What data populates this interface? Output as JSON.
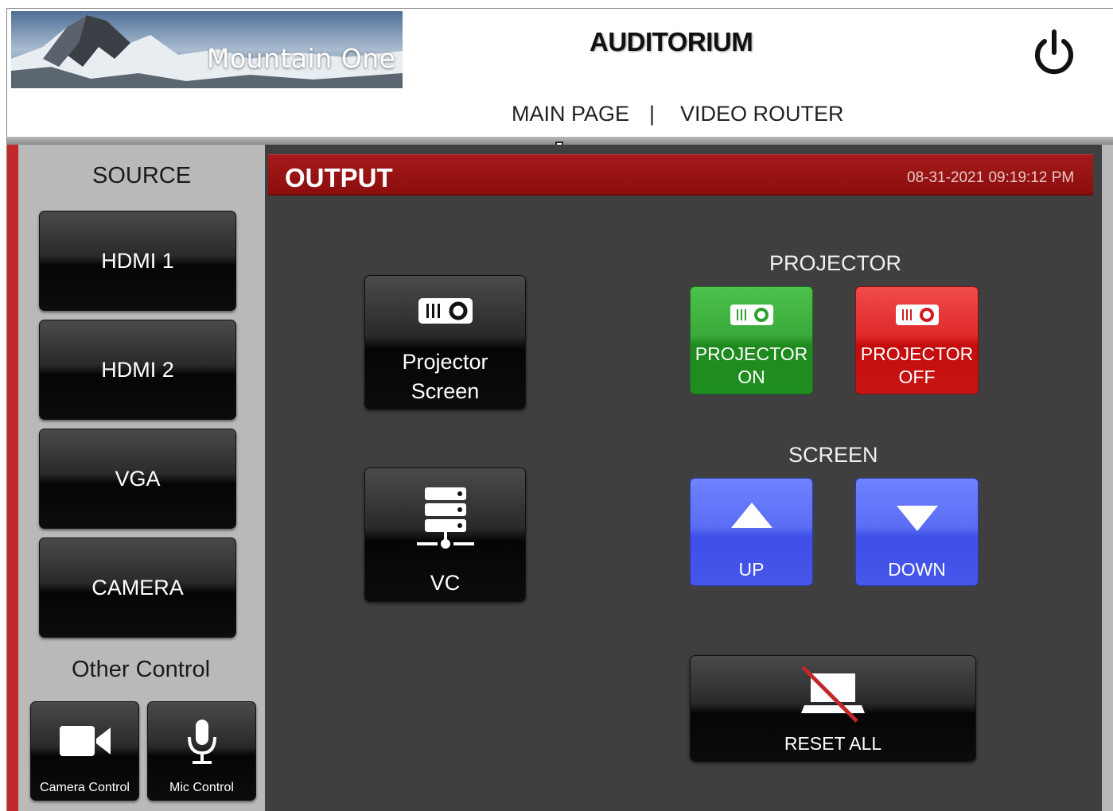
{
  "header": {
    "logo_text": "Mountain One",
    "title": "AUDITORIUM",
    "power_icon": "power-icon",
    "nav": {
      "main_page": "MAIN PAGE",
      "separator": "|",
      "video_router": "VIDEO ROUTER"
    }
  },
  "source": {
    "title": "SOURCE",
    "buttons": [
      "HDMI 1",
      "HDMI 2",
      "VGA",
      "CAMERA"
    ],
    "other_title": "Other Control",
    "other_buttons": [
      {
        "label": "Camera Control",
        "icon": "video-camera-icon"
      },
      {
        "label": "Mic Control",
        "icon": "microphone-icon"
      }
    ]
  },
  "output": {
    "title": "OUTPUT",
    "datetime": "08-31-2021 09:19:12 PM",
    "buttons": [
      {
        "label_line1": "Projector",
        "label_line2": "Screen",
        "icon": "projector-icon"
      },
      {
        "label": "VC",
        "icon": "server-network-icon"
      }
    ]
  },
  "projector": {
    "title": "PROJECTOR",
    "on": {
      "line1": "PROJECTOR",
      "line2": "ON",
      "color": "#2fa02f"
    },
    "off": {
      "line1": "PROJECTOR",
      "line2": "OFF",
      "color": "#d01c1c"
    }
  },
  "screen": {
    "title": "SCREEN",
    "up": {
      "label": "UP",
      "icon": "triangle-up-icon",
      "color": "#4f62f0"
    },
    "down": {
      "label": "DOWN",
      "icon": "triangle-down-icon",
      "color": "#4f62f0"
    }
  },
  "reset": {
    "label": "RESET ALL",
    "icon": "laptop-off-icon"
  },
  "colors": {
    "accent_red": "#8c0d0d",
    "panel_dark": "#3f3f3f",
    "panel_gray": "#b9b9b9"
  }
}
